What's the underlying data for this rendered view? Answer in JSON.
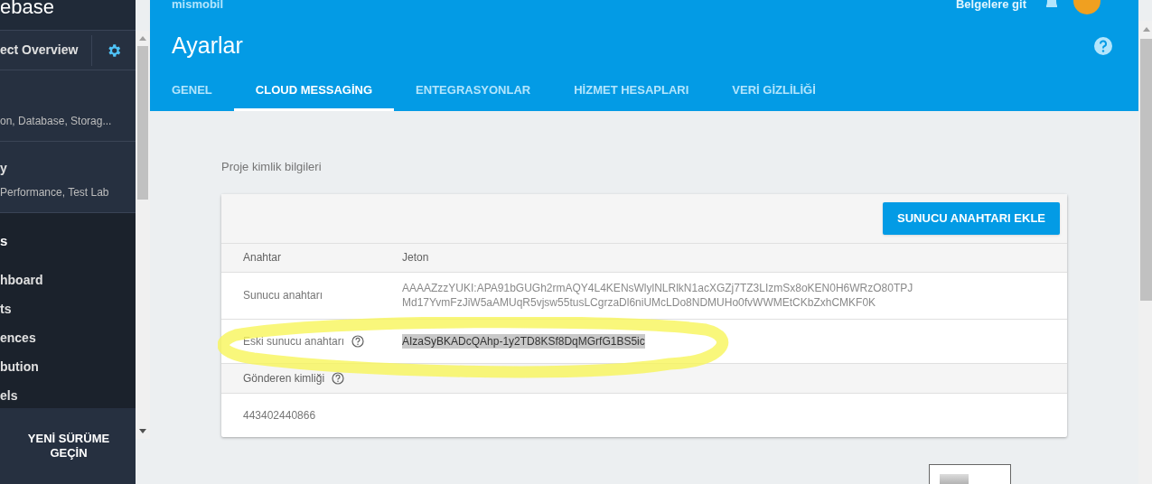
{
  "sidebar": {
    "logo_fragment": "ebase",
    "project_overview": "ect Overview",
    "sections": [
      {
        "subtitle": "on, Database, Storag..."
      },
      {
        "title": "y",
        "subtitle": "Performance, Test Lab"
      }
    ],
    "analytics": {
      "title": "s",
      "items": [
        {
          "label": "hboard"
        },
        {
          "label": "ts"
        },
        {
          "label": "ences"
        },
        {
          "label": "bution"
        },
        {
          "label": "els"
        }
      ]
    },
    "upgrade_button": "YENİ SÜRÜME GEÇİN"
  },
  "topbar": {
    "project": "mismobil",
    "docs_link": "Belgelere git"
  },
  "header": {
    "title": "Ayarlar"
  },
  "tabs": [
    {
      "label": "GENEL",
      "selected": false
    },
    {
      "label": "CLOUD MESSAGİNG",
      "selected": true
    },
    {
      "label": "ENTEGRASYONLAR",
      "selected": false
    },
    {
      "label": "HİZMET HESAPLARI",
      "selected": false
    },
    {
      "label": "VERİ GİZLİLİĞİ",
      "selected": false
    }
  ],
  "section_title": "Proje kimlik bilgileri",
  "add_key_button": "SUNUCU ANAHTARI EKLE",
  "table": {
    "columns": [
      "Anahtar",
      "Jeton"
    ],
    "rows": [
      {
        "key": "Sunucu anahtarı",
        "help": false,
        "token_lines": [
          "AAAAZzzYUKI:APA91bGUGh2rmAQY4L4KENsWlylNLRlkN1acXGZj7TZ3LIzmSx8oKEN0H6WRzO80TPJ",
          "Md17YvmFzJiW5aAMUqR5vjsw55tusLCgrzaDl6niUMcLDo8NDMUHo0fvWWMEtCKbZxhCMKF0K"
        ],
        "selected": false
      },
      {
        "key": "Eski sunucu anahtarı",
        "help": true,
        "token_lines": [
          "AIzaSyBKADcQAhp-1y2TD8KSf8DqMGrfG1BS5ic"
        ],
        "selected": true
      }
    ]
  },
  "sender": {
    "label": "Gönderen kimliği",
    "value": "443402440866"
  }
}
